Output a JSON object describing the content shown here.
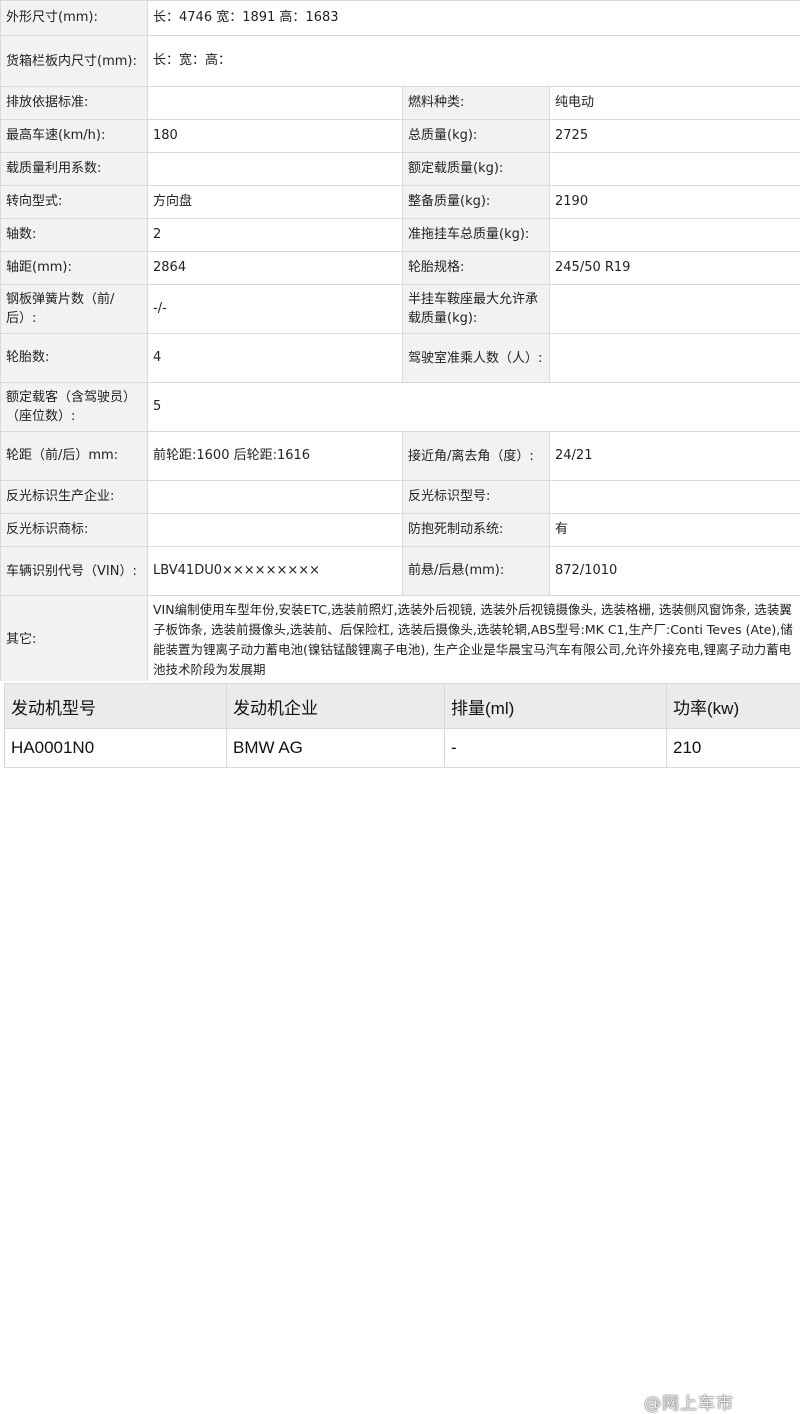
{
  "spec": {
    "r0": {
      "l1": "外形尺寸(mm):",
      "v1": "长：4746 宽：1891 高：1683"
    },
    "r1": {
      "l1": "货箱栏板内尺寸(mm):",
      "v1": "长：宽：高："
    },
    "r2": {
      "l1": "排放依据标准:",
      "v1": "",
      "l2": "燃料种类:",
      "v2": "纯电动"
    },
    "r3": {
      "l1": "最高车速(km/h):",
      "v1": "180",
      "l2": "总质量(kg):",
      "v2": "2725"
    },
    "r4": {
      "l1": "载质量利用系数:",
      "v1": "",
      "l2": "额定载质量(kg):",
      "v2": ""
    },
    "r5": {
      "l1": "转向型式:",
      "v1": "方向盘",
      "l2": "整备质量(kg):",
      "v2": "2190"
    },
    "r6": {
      "l1": "轴数:",
      "v1": "2",
      "l2": "准拖挂车总质量(kg):",
      "v2": ""
    },
    "r7": {
      "l1": "轴距(mm):",
      "v1": "2864",
      "l2": "轮胎规格:",
      "v2": "245/50 R19"
    },
    "r8": {
      "l1": "钢板弹簧片数（前/后）:",
      "v1": "-/-",
      "l2": "半挂车鞍座最大允许承载质量(kg):",
      "v2": ""
    },
    "r9": {
      "l1": "轮胎数:",
      "v1": "4",
      "l2": "驾驶室准乘人数（人）:",
      "v2": ""
    },
    "r10": {
      "l1": "额定载客（含驾驶员）（座位数）:",
      "v1": "5"
    },
    "r11": {
      "l1": "轮距（前/后）mm:",
      "v1": "前轮距:1600 后轮距:1616",
      "l2": "接近角/离去角（度）:",
      "v2": "24/21"
    },
    "r12": {
      "l1": "反光标识生产企业:",
      "v1": "",
      "l2": "反光标识型号:",
      "v2": ""
    },
    "r13": {
      "l1": "反光标识商标:",
      "v1": "",
      "l2": "防抱死制动系统:",
      "v2": "有"
    },
    "r14": {
      "l1": "车辆识别代号（VIN）:",
      "v1": "LBV41DU0×××××××××",
      "l2": "前悬/后悬(mm):",
      "v2": "872/1010"
    },
    "r15": {
      "l1": "其它:",
      "v1": "VIN编制使用车型年份,安装ETC,选装前照灯,选装外后视镜, 选装外后视镜摄像头, 选装格栅, 选装侧风窗饰条, 选装翼子板饰条, 选装前摄像头,选装前、后保险杠, 选装后摄像头,选装轮辋,ABS型号:MK C1,生产厂:Conti Teves (Ate),储能装置为锂离子动力蓄电池(镍钴锰酸锂离子电池), 生产企业是华晨宝马汽车有限公司,允许外接充电,锂离子动力蓄电池技术阶段为发展期"
    }
  },
  "engine": {
    "headers": [
      "发动机型号",
      "发动机企业",
      "排量(ml)",
      "功率(kw)"
    ],
    "row": [
      "HA0001N0",
      "BMW AG",
      "-",
      "210"
    ]
  },
  "watermark": "@网上车市"
}
